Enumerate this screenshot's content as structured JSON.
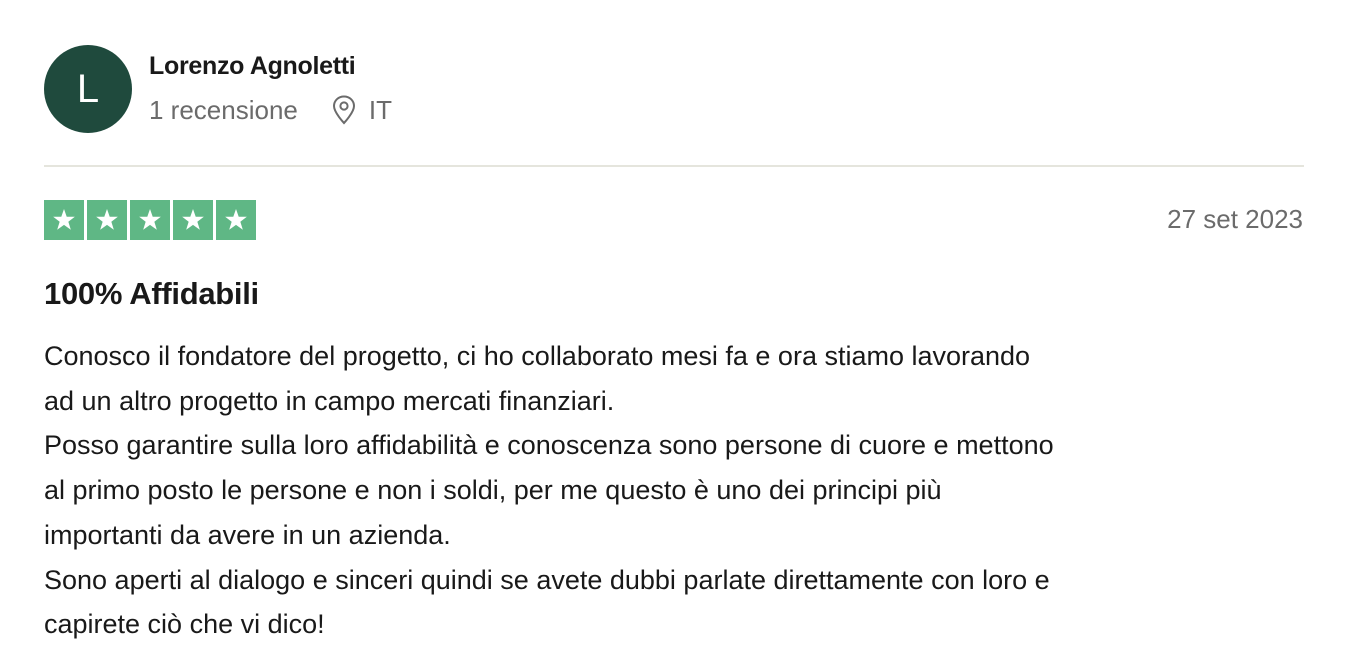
{
  "reviewer": {
    "initial": "L",
    "name": "Lorenzo Agnoletti",
    "reviews_count": "1 recensione",
    "location_icon": "location-pin-icon",
    "country": "IT",
    "avatar_color": "#1f4a3d"
  },
  "review": {
    "rating": 5,
    "rating_max": 5,
    "star_color": "#5fb785",
    "date": "27 set 2023",
    "title": "100% Affidabili",
    "body_lines": [
      "Conosco il fondatore del progetto, ci ho collaborato mesi fa e ora stiamo lavorando",
      "ad un altro progetto in campo mercati finanziari.",
      "Posso garantire sulla loro affidabilità e conoscenza sono persone di cuore e mettono",
      "al primo posto le persone e non i soldi, per me questo è uno dei principi più",
      "importanti da avere in un azienda.",
      "Sono aperti al dialogo e sinceri quindi se avete dubbi parlate direttamente con loro e",
      "capirete ciò che vi dico!"
    ]
  }
}
